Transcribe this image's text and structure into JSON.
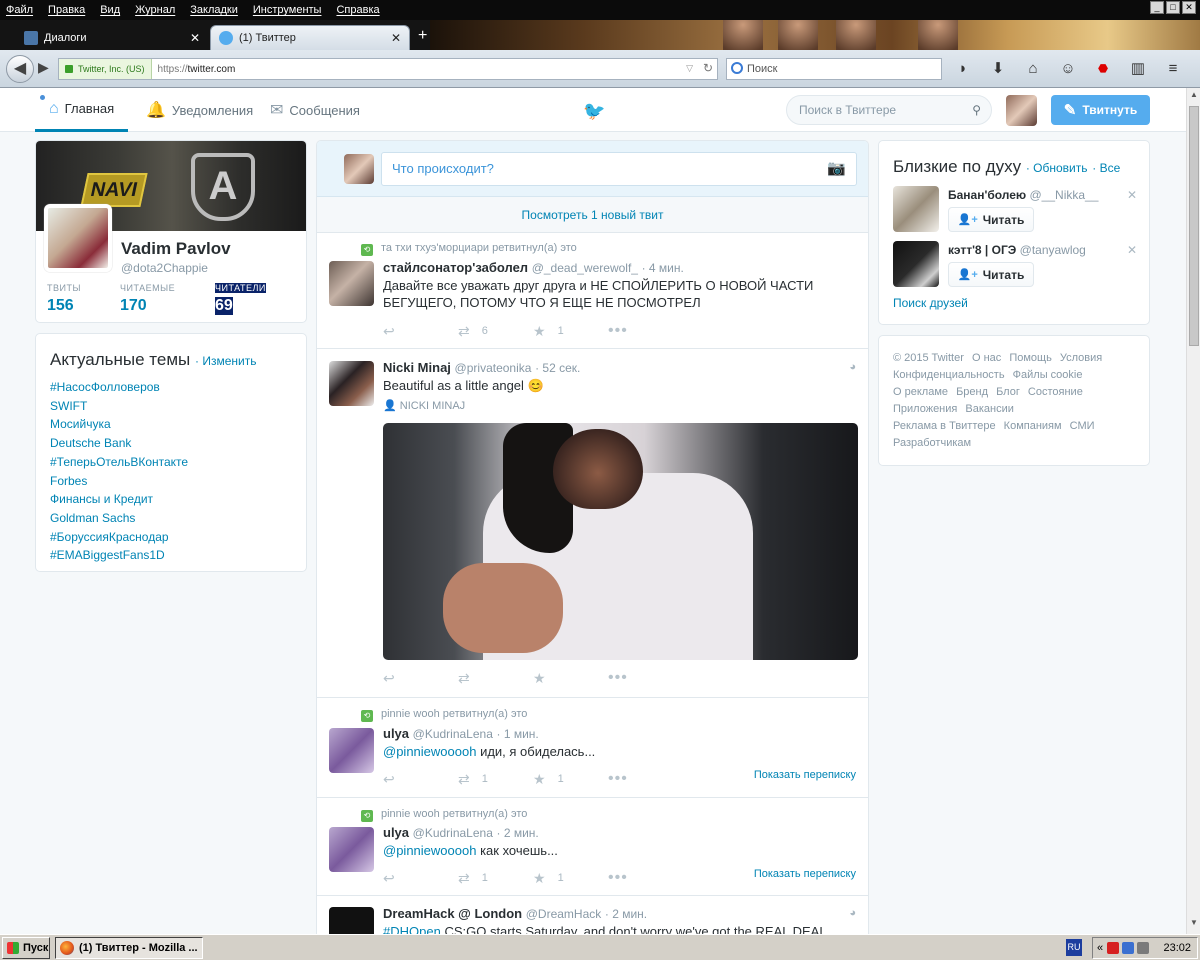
{
  "browser": {
    "menu": [
      "Файл",
      "Правка",
      "Вид",
      "Журнал",
      "Закладки",
      "Инструменты",
      "Справка"
    ],
    "tabs": [
      {
        "title": "Диалоги",
        "active": false
      },
      {
        "title": "(1) Твиттер",
        "active": true
      }
    ],
    "new_tab": "+",
    "identity": "Twitter, Inc. (US)",
    "url_proto": "https://",
    "url_host": "twitter.com",
    "search_placeholder": "Поиск",
    "window_buttons": [
      "_",
      "□",
      "✕"
    ]
  },
  "nav": {
    "home": "Главная",
    "notifications": "Уведомления",
    "messages": "Сообщения",
    "search_placeholder": "Поиск в Твиттере",
    "tweet_button": "Твитнуть"
  },
  "profile": {
    "name": "Vadim Pavlov",
    "handle": "@dota2Chappie",
    "stats": [
      {
        "label": "ТВИТЫ",
        "value": "156"
      },
      {
        "label": "ЧИТАЕМЫЕ",
        "value": "170"
      },
      {
        "label": "ЧИТАТЕЛИ",
        "value": "69"
      }
    ],
    "banner_logo_1": "NAVI",
    "banner_logo_2": "A"
  },
  "trends": {
    "title": "Актуальные темы",
    "change": "Изменить",
    "items": [
      "#НасосФолловеров",
      "SWIFT",
      "Мосийчука",
      "Deutsche Bank",
      "#ТеперьОтельВКонтакте",
      "Forbes",
      "Финансы и Кредит",
      "Goldman Sachs",
      "#БоруссияКраснодар",
      "#EMABiggestFans1D"
    ]
  },
  "timeline": {
    "composer_placeholder": "Что происходит?",
    "new_tweets": "Посмотреть 1 новый твит",
    "tweets": [
      {
        "context": "та тхи тхуэ'морциари ретвитнул(а) это",
        "name": "стайлсонатор'заболел",
        "handle": "@_dead_werewolf_",
        "time": "· 4 мин.",
        "text": "Давайте все уважать друг друга и НЕ СПОЙЛЕРИТЬ О НОВОЙ ЧАСТИ БЕГУЩЕГО, ПОТОМУ ЧТО Я ЕЩЕ НЕ ПОСМОТРЕЛ",
        "retweets": "6",
        "likes": "1"
      },
      {
        "name": "Nicki Minaj",
        "handle": "@privateonika",
        "time": "· 52 сек.",
        "text": "Beautiful as a little angel",
        "emoji": "😊",
        "geo": "NICKI MINAJ"
      },
      {
        "context": "pinnie wooh ретвитнул(а) это",
        "name": "ulya",
        "handle": "@KudrinaLena",
        "time": "· 1 мин.",
        "mention": "@pinniewooooh",
        "text": "иди, я обиделась...",
        "retweets": "1",
        "likes": "1",
        "conversation": "Показать переписку"
      },
      {
        "context": "pinnie wooh ретвитнул(а) это",
        "name": "ulya",
        "handle": "@KudrinaLena",
        "time": "· 2 мин.",
        "mention": "@pinniewooooh",
        "text": "как хочешь...",
        "retweets": "1",
        "likes": "1",
        "conversation": "Показать переписку"
      },
      {
        "name": "DreamHack @ London",
        "handle": "@DreamHack",
        "time": "· 2 мин.",
        "mention": "#DHOpen",
        "text": "CS:GO starts Saturday, and don't worry we've got the REAL DEAL"
      }
    ]
  },
  "who_to_follow": {
    "title": "Близкие по духу",
    "refresh": "Обновить",
    "all": "Все",
    "items": [
      {
        "name": "Банан'болею",
        "handle": "@__Nikka__",
        "follow": "Читать"
      },
      {
        "name": "кэтт'8 | ОГЭ",
        "handle": "@tanyawlog",
        "follow": "Читать"
      }
    ],
    "find_friends": "Поиск друзей"
  },
  "footer": {
    "links": [
      "© 2015 Twitter",
      "О нас",
      "Помощь",
      "Условия",
      "Конфиденциальность",
      "Файлы cookie",
      "О рекламе",
      "Бренд",
      "Блог",
      "Состояние",
      "Приложения",
      "Вакансии",
      "Реклама в Твиттере",
      "Компаниям",
      "СМИ",
      "Разработчикам"
    ]
  },
  "taskbar": {
    "start": "Пуск",
    "task": "(1) Твиттер - Mozilla ...",
    "lang": "RU",
    "tray_chevron": "«",
    "clock": "23:02"
  },
  "colors": {
    "twitter_blue": "#55acee",
    "link": "#0084b4",
    "retweet_green": "#5fb850"
  }
}
